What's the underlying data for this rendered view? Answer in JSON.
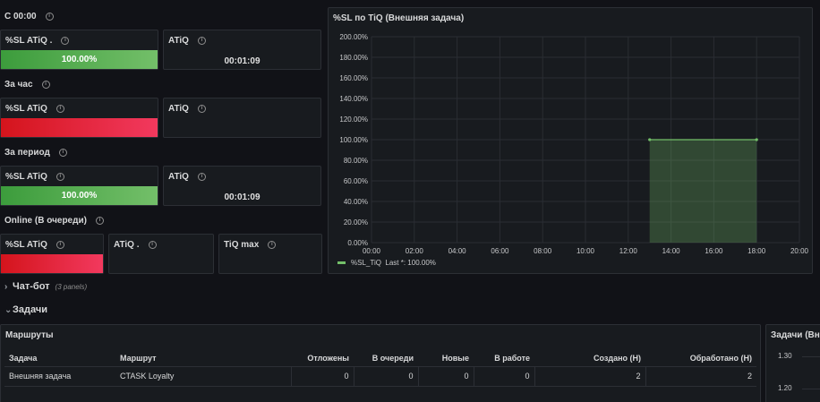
{
  "sections": {
    "since_midnight": "С 00:00",
    "per_hour": "За час",
    "per_period": "За период",
    "online_queue": "Online (В очереди)"
  },
  "panels": {
    "sl_1": {
      "title": "%SL ATiQ .",
      "value": "100.00%",
      "level": 100
    },
    "atiq_1": {
      "title": "ATiQ",
      "value": "00:01:09"
    },
    "sl_2": {
      "title": "%SL ATiQ",
      "value": "",
      "level": 100
    },
    "atiq_2": {
      "title": "ATiQ",
      "value": ""
    },
    "sl_3": {
      "title": "%SL ATiQ",
      "value": "100.00%",
      "level": 100
    },
    "atiq_3": {
      "title": "ATiQ",
      "value": "00:01:09"
    },
    "sl_4": {
      "title": "%SL ATiQ",
      "value": "",
      "level": 100
    },
    "atiq_4": {
      "title": "ATiQ .",
      "value": ""
    },
    "tiq_max": {
      "title": "TiQ max",
      "value": ""
    }
  },
  "chart_data": {
    "type": "area",
    "title": "%SL по TiQ (Внешняя задача)",
    "x_ticks": [
      "00:00",
      "02:00",
      "04:00",
      "06:00",
      "08:00",
      "10:00",
      "12:00",
      "14:00",
      "16:00",
      "18:00",
      "20:00"
    ],
    "y_ticks": [
      "0.00%",
      "20.00%",
      "40.00%",
      "60.00%",
      "80.00%",
      "100.00%",
      "120.00%",
      "140.00%",
      "160.00%",
      "180.00%",
      "200.00%"
    ],
    "xlim": [
      0,
      20
    ],
    "ylim": [
      0,
      200
    ],
    "series": [
      {
        "name": "%SL_TiQ",
        "legend": "Last *: 100.00%",
        "x": [
          13,
          18
        ],
        "y": [
          100,
          100
        ],
        "color": "#73bf69"
      }
    ],
    "grid": true,
    "legend": "bottom-left"
  },
  "chat_bot": {
    "title": "Чат-бот",
    "sub": "(3 panels)"
  },
  "tasks": {
    "title": "Задачи"
  },
  "routes_table": {
    "title": "Маршруты",
    "columns": [
      "Задача",
      "Маршрут",
      "Отложены",
      "В очереди",
      "Новые",
      "В работе",
      "Создано (Н)",
      "Обработано (Н)"
    ],
    "rows": [
      [
        "Внешняя задача",
        "CTASK Loyalty",
        "0",
        "0",
        "0",
        "0",
        "2",
        "2"
      ]
    ]
  },
  "tasks_panel": {
    "title": "Задачи (Вне",
    "y_ticks": [
      "1.30",
      "1.20"
    ]
  }
}
